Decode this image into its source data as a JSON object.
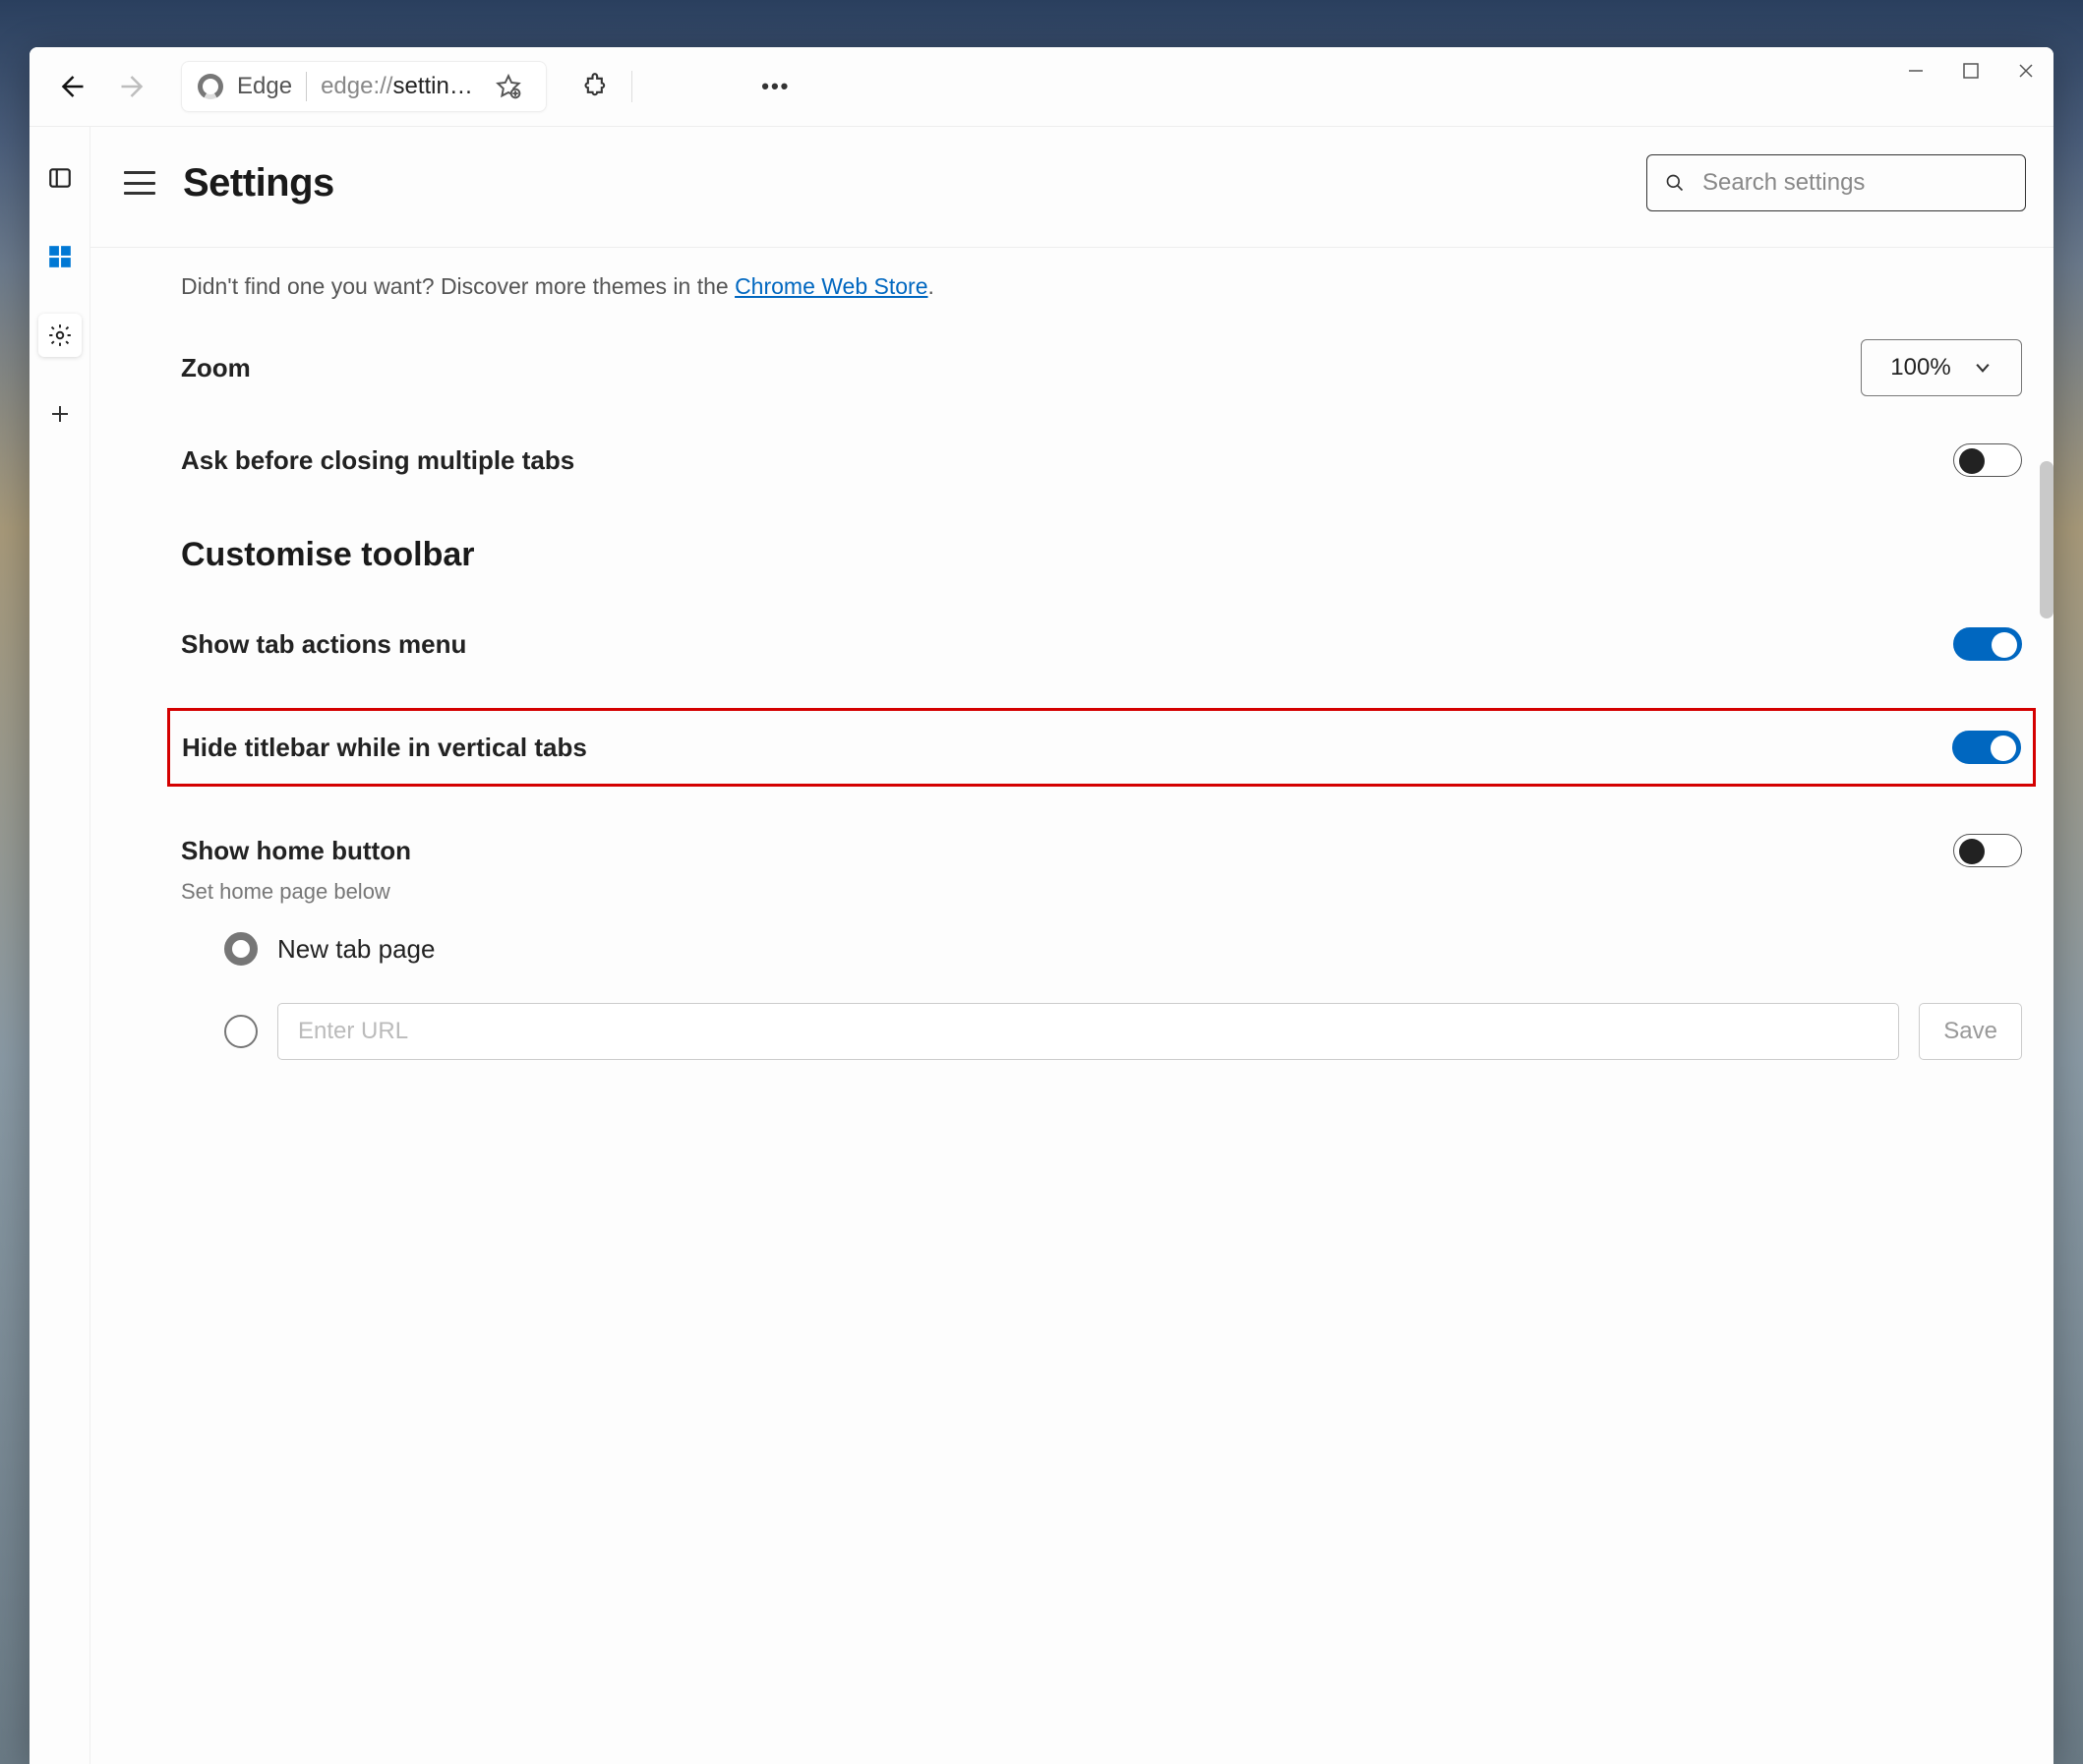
{
  "tab": {
    "app_name": "Edge",
    "url_prefix": "edge://",
    "url_rest": "settin…"
  },
  "header": {
    "title": "Settings",
    "search_placeholder": "Search settings"
  },
  "theme_note": {
    "prefix": "Didn't find one you want? Discover more themes in the ",
    "link_text": "Chrome Web Store",
    "suffix": "."
  },
  "zoom": {
    "label": "Zoom",
    "value": "100%"
  },
  "ask_close": {
    "label": "Ask before closing multiple tabs",
    "enabled": false
  },
  "section_toolbar": "Customise toolbar",
  "show_tab_actions": {
    "label": "Show tab actions menu",
    "enabled": true
  },
  "hide_titlebar": {
    "label": "Hide titlebar while in vertical tabs",
    "enabled": true
  },
  "show_home": {
    "label": "Show home button",
    "sub": "Set home page below",
    "enabled": false
  },
  "home_options": {
    "new_tab": "New tab page",
    "url_placeholder": "Enter URL",
    "save": "Save"
  }
}
